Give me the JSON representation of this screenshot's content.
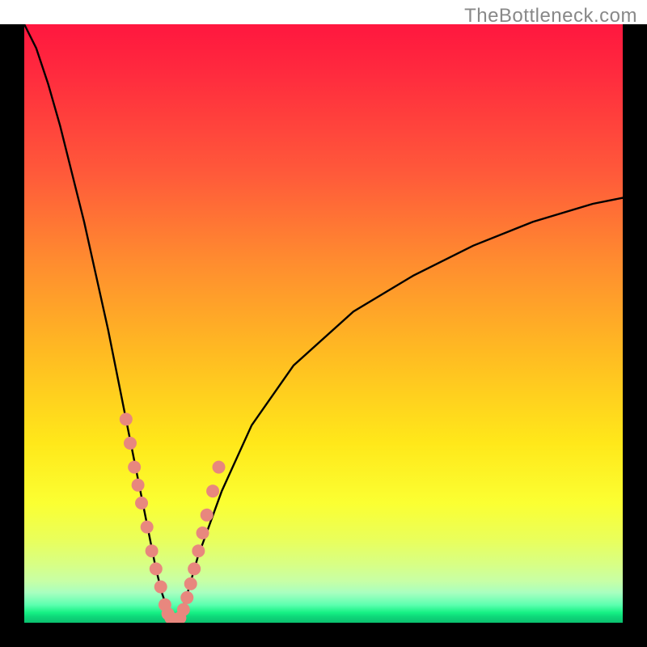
{
  "watermark": "TheBottleneck.com",
  "chart_data": {
    "type": "line",
    "title": "",
    "xlabel": "",
    "ylabel": "",
    "xlim": [
      0,
      100
    ],
    "ylim": [
      0,
      100
    ],
    "gradient_stops": [
      {
        "pct": 0,
        "color": "#ff173f"
      },
      {
        "pct": 25,
        "color": "#ff5a3a"
      },
      {
        "pct": 55,
        "color": "#ffbb22"
      },
      {
        "pct": 80,
        "color": "#fbff32"
      },
      {
        "pct": 95,
        "color": "#a8ffc0"
      },
      {
        "pct": 100,
        "color": "#0bc06e"
      }
    ],
    "series": [
      {
        "name": "bottleneck-curve",
        "type": "line",
        "color": "#000000",
        "x": [
          0,
          2,
          4,
          6,
          8,
          10,
          12,
          14,
          16,
          18,
          19,
          20,
          21,
          22,
          23,
          24,
          24.5,
          25,
          25.3,
          25.7,
          26,
          27,
          29,
          33,
          38,
          45,
          55,
          65,
          75,
          85,
          95,
          100
        ],
        "y": [
          100,
          96,
          90,
          83,
          75,
          67,
          58,
          49,
          39,
          29,
          24,
          19,
          14,
          9,
          5,
          2,
          1,
          0.3,
          0.2,
          0.3,
          1,
          4,
          11,
          22,
          33,
          43,
          52,
          58,
          63,
          67,
          70,
          71
        ]
      },
      {
        "name": "marker-dots",
        "type": "scatter",
        "color": "#e8877e",
        "x": [
          17.0,
          17.7,
          18.4,
          19.0,
          19.6,
          20.5,
          21.3,
          22.0,
          22.8,
          23.5,
          24.0,
          24.5,
          25.0,
          25.5,
          26.0,
          26.6,
          27.2,
          27.8,
          28.4,
          29.1,
          29.8,
          30.5,
          31.5,
          32.5
        ],
        "y": [
          34,
          30,
          26,
          23,
          20,
          16,
          12,
          9,
          6,
          3,
          1.5,
          0.8,
          0.3,
          0.3,
          0.8,
          2.2,
          4.2,
          6.5,
          9,
          12,
          15,
          18,
          22,
          26
        ]
      }
    ]
  }
}
